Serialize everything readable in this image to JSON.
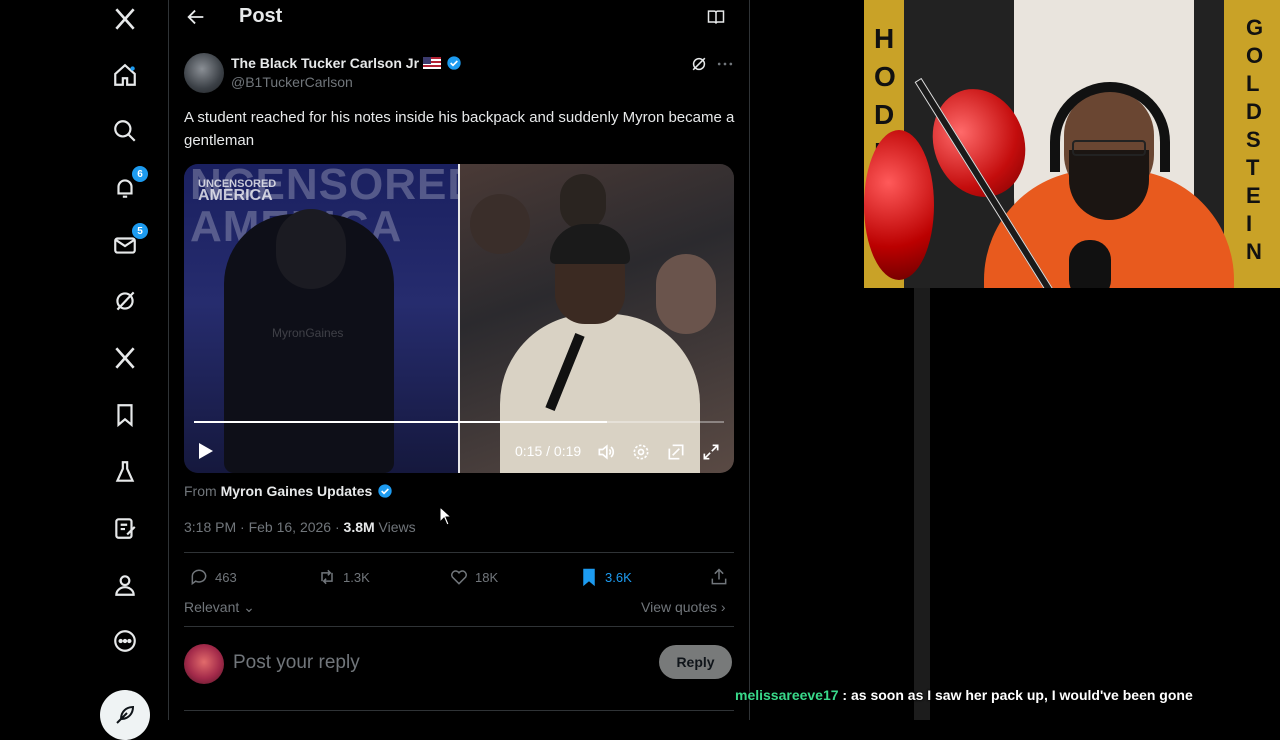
{
  "nav": {
    "notifications_badge": "6",
    "messages_badge": "5"
  },
  "header": {
    "title": "Post"
  },
  "post": {
    "author_name": "The Black Tucker Carlson Jr",
    "handle": "@B1TuckerCarlson",
    "text": "A student reached for his notes inside his backpack and suddenly Myron became a gentleman",
    "video": {
      "logo_line1": "UNCENSORED",
      "logo_line2": "AMERICA",
      "wall_text": "NCENSORED AMERICA",
      "watermark": "MyronGaines",
      "time_readout": "0:15 / 0:19",
      "progress_fraction": 0.78
    },
    "from_prefix": "From",
    "from_account": "Myron Gaines Updates",
    "timestamp": "3:18 PM · Feb 16, 2026 · ",
    "views_count": "3.8M",
    "views_label": " Views",
    "stats": {
      "replies": "463",
      "reposts": "1.3K",
      "likes": "18K",
      "bookmarks": "3.6K"
    },
    "sort_label": "Relevant",
    "view_quotes": "View quotes"
  },
  "reply": {
    "placeholder": "Post your reply",
    "button_label": "Reply"
  },
  "webcam": {
    "banner_left": "H\nO\nD\nL",
    "banner_right": "G\nO\nL\nD\nS\nT\nE\nI\nN"
  },
  "chat": {
    "username": "melissareeve17",
    "message": " : as soon as I saw her pack up, I would've been gone"
  },
  "colors": {
    "accent": "#1d9bf0",
    "background": "#000000",
    "muted_text": "#71767b",
    "chat_username": "#39d98a"
  }
}
